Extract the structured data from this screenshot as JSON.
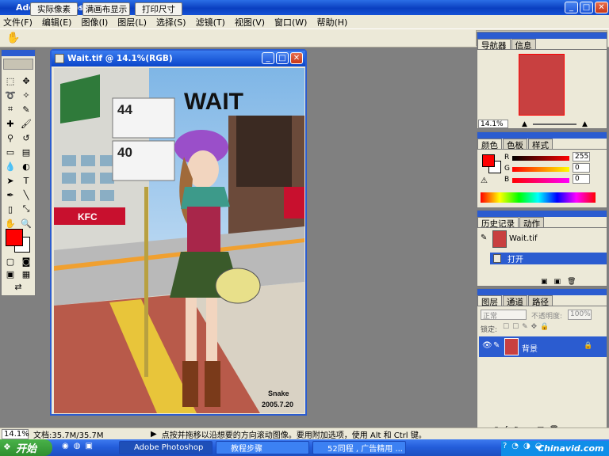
{
  "window": {
    "title": "Adobe Photoshop"
  },
  "menu": [
    "文件(F)",
    "编辑(E)",
    "图像(I)",
    "图层(L)",
    "选择(S)",
    "滤镜(T)",
    "视图(V)",
    "窗口(W)",
    "帮助(H)"
  ],
  "options": {
    "actual_pixels": "实际像素",
    "fit_screen": "满画布显示",
    "print_size": "打印尺寸"
  },
  "document": {
    "title": "Wait.tif @ 14.1%(RGB)",
    "art_title": "WAIT",
    "sign1_number": "44",
    "sign2_number": "40",
    "store_kfc": "KFC",
    "signature": "Snake",
    "date": "2005.7.20"
  },
  "navigator": {
    "tabs": [
      "导航器",
      "信息"
    ],
    "zoom": "14.1%"
  },
  "color": {
    "tabs": [
      "颜色",
      "色板",
      "样式"
    ],
    "r_label": "R",
    "g_label": "G",
    "b_label": "B",
    "r": "255",
    "g": "0",
    "b": "0",
    "fg_color": "#ff0000",
    "bg_color": "#ffffff"
  },
  "history": {
    "tabs": [
      "历史记录",
      "动作"
    ],
    "snapshot": "Wait.tif",
    "step": "打开"
  },
  "layers": {
    "tabs": [
      "图层",
      "通道",
      "路径"
    ],
    "blend": "正常",
    "opacity_label": "不透明度:",
    "opacity": "100%",
    "lock_label": "锁定:",
    "layer_name": "背景"
  },
  "status": {
    "zoom": "14.1%",
    "doc": "文档:35.7M/35.7M",
    "hint": "点按并拖移以沿想要的方向滚动图像。要用附加选项，使用 Alt 和 Ctrl 键。"
  },
  "taskbar": {
    "start": "开始",
    "tasks": [
      "Adobe Photoshop",
      "教程步骤",
      "52同程 , 广告精用 ..."
    ],
    "watermark": "Chinavid.com"
  }
}
